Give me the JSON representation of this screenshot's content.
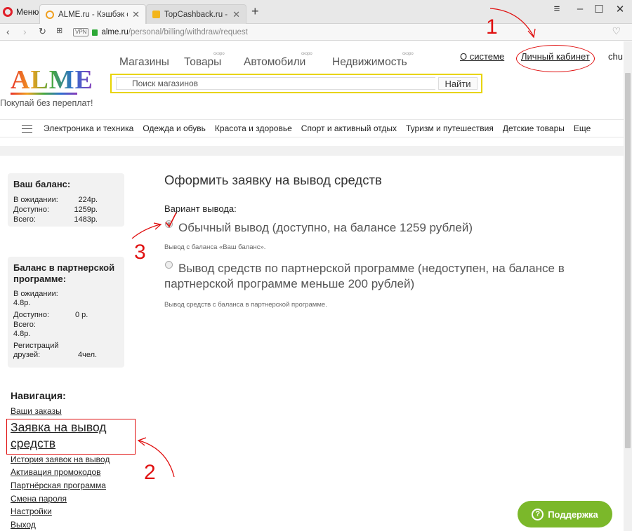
{
  "browser": {
    "menu_label": "Меню",
    "tabs": [
      {
        "title": "ALME.ru - Кэшбэк сервис"
      },
      {
        "title": "TopCashback.ru - Топ лучш"
      }
    ],
    "address": {
      "vpn": "VPN",
      "domain": "alme.ru",
      "path": "/personal/billing/withdraw/request"
    }
  },
  "site": {
    "logo": "ALME",
    "tagline": "Покупай без переплат!",
    "topnav": [
      {
        "label": "Магазины",
        "soon": ""
      },
      {
        "label": "Товары",
        "soon": "скоро"
      },
      {
        "label": "Автомобили",
        "soon": "скоро"
      },
      {
        "label": "Недвижимость",
        "soon": "скоро"
      }
    ],
    "about": "О системе",
    "cabinet": "Личный кабинет",
    "user": "chu",
    "search": {
      "placeholder": "Поиск магазинов",
      "button": "Найти"
    },
    "categories": [
      "Электроника и техника",
      "Одежда и обувь",
      "Красота и здоровье",
      "Спорт и активный отдых",
      "Туризм и путешествия",
      "Детские товары",
      "Еще"
    ]
  },
  "sidebar": {
    "balance": {
      "title": "Ваш баланс:",
      "rows": [
        {
          "label": "В ожидании:",
          "value": "224р."
        },
        {
          "label": "Доступно:",
          "value": "1259р."
        },
        {
          "label": "Всего:",
          "value": "1483р."
        }
      ]
    },
    "partner": {
      "title": "Баланс в партнерской программе:",
      "pending_label": "В ожидании:",
      "pending_value": "4.8р.",
      "available_label": "Доступно:",
      "available_value": "0 р.",
      "total_label": "Всего:",
      "total_value": "4.8р.",
      "friends_label": "Регистраций друзей:",
      "friends_value": "4чел."
    },
    "nav_title": "Навигация:",
    "nav": [
      "Ваши заказы",
      "Заявка на вывод средств",
      "История заявок на вывод",
      "Активация промокодов",
      "Партнёрская программа",
      "Смена пароля",
      "Настройки",
      "Выход"
    ]
  },
  "main": {
    "heading": "Оформить заявку на вывод средств",
    "variant_label": "Вариант вывода:",
    "options": [
      {
        "label": "Обычный вывод (доступно, на балансе 1259 рублей)",
        "hint": "Вывод с баланса «Ваш баланс».",
        "selected": true
      },
      {
        "label": "Вывод средств по партнерской программе (недоступен, на балансе в партнерской программе меньше 200 рублей)",
        "hint": "Вывод средств с баланса в партнерской программе.",
        "selected": false
      }
    ]
  },
  "annotations": {
    "one": "1",
    "two": "2",
    "three": "3"
  },
  "support": {
    "label": "Поддержка"
  },
  "colors": {
    "support_green": "#7bb82a",
    "annotation_red": "#e01010",
    "search_border": "#e8d400"
  }
}
